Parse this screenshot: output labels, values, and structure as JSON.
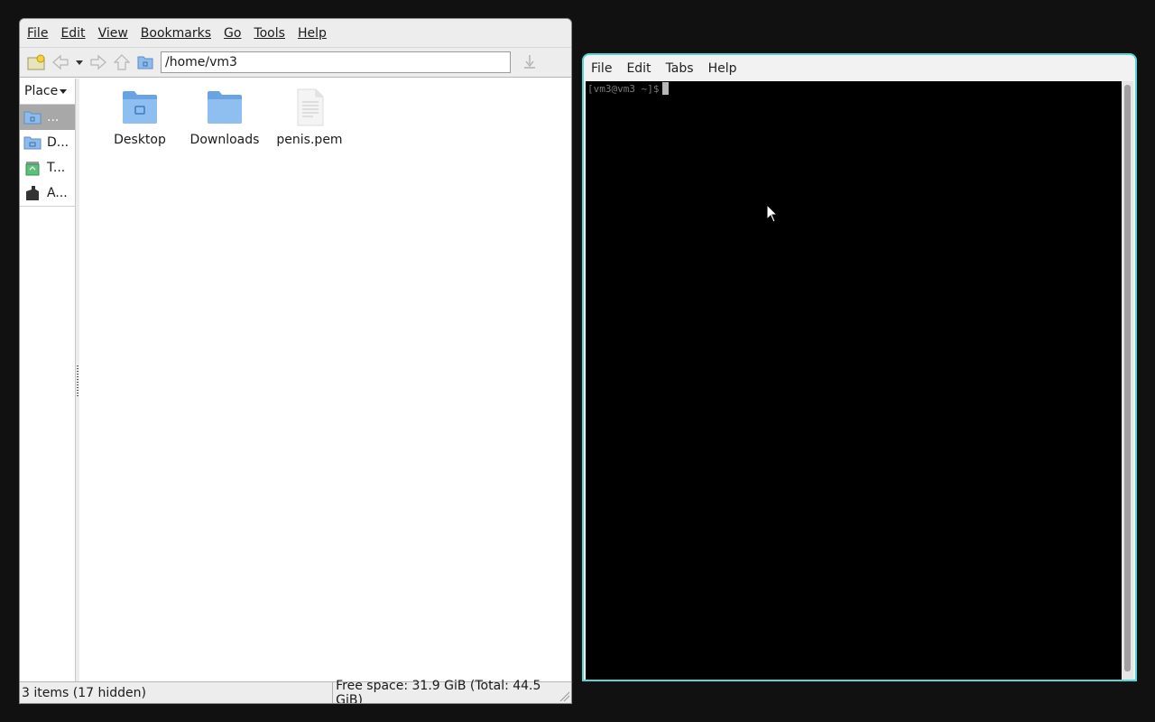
{
  "file_manager": {
    "menu": [
      "File",
      "Edit",
      "View",
      "Bookmarks",
      "Go",
      "Tools",
      "Help"
    ],
    "address": "/home/vm3",
    "places_label": "Place",
    "places": [
      {
        "label": "...",
        "icon": "home-folder-icon",
        "selected": true
      },
      {
        "label": "D...",
        "icon": "desktop-folder-icon",
        "selected": false
      },
      {
        "label": "T...",
        "icon": "trash-icon",
        "selected": false
      },
      {
        "label": "A...",
        "icon": "applications-icon",
        "selected": false
      }
    ],
    "items": [
      {
        "label": "Desktop",
        "icon": "desktop-folder-icon"
      },
      {
        "label": "Downloads",
        "icon": "folder-icon"
      },
      {
        "label": "penis.pem",
        "icon": "text-file-icon"
      }
    ],
    "status_left": "3 items (17 hidden)",
    "status_right": "Free space: 31.9 GiB (Total: 44.5 GiB)"
  },
  "terminal": {
    "menu": [
      "File",
      "Edit",
      "Tabs",
      "Help"
    ],
    "prompt": "[vm3@vm3 ~]$"
  },
  "colors": {
    "terminal_border": "#52d8d2",
    "folder_blue": "#7fb2ea",
    "selection_gray": "#a8a8a8"
  }
}
